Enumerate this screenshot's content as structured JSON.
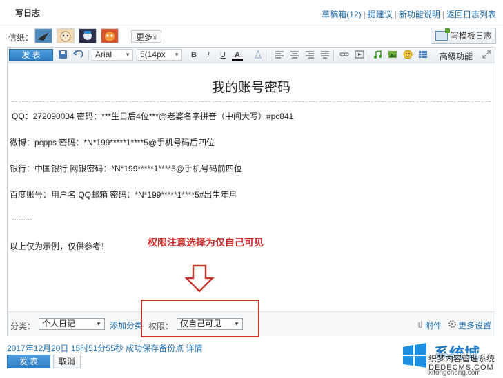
{
  "header": {
    "title": "写日志",
    "links": [
      "草稿箱(12)",
      "提建议",
      "新功能说明",
      "返回日志列表"
    ],
    "separator": "|"
  },
  "papers": {
    "label": "信纸：",
    "more_label": "更多",
    "more_arrow": "¥",
    "template_button": "写模板日志"
  },
  "toolbar": {
    "publish_label": "发 表",
    "font_family": "Arial",
    "font_size": "5(14px",
    "bold": "B",
    "italic": "I",
    "underline": "U",
    "font_color": "A",
    "advanced": "高级功能"
  },
  "document": {
    "title": "我的账号密码",
    "lines": [
      "QQ：272090034 密码：***生日后4位***@老婆名字拼音（中间大写）#pc841",
      "微博：pcpps 密码：*N*199*****1****5@手机号码后四位",
      "银行：中国银行 网银密码：*N*199*****1****5@手机号码前四位",
      "百度账号：用户名 QQ邮箱 密码：*N*199*****1****5#出生年月",
      "………",
      "以上仅为示例，仅供参考！"
    ],
    "annotation": "权限注意选择为仅自己可见"
  },
  "footer": {
    "category_label": "分类：",
    "category_value": "个人日记",
    "add_category": "添加分类",
    "permission_label": "权限：",
    "permission_value": "仅自己可见",
    "attachment": "附件",
    "more_settings": "更多设置"
  },
  "status": {
    "saved_text": "2017年12月20日 15时51分55秒 成功保存备份点",
    "details_link": "详情"
  },
  "actions": {
    "publish": "发 表",
    "cancel": "取消"
  },
  "watermark": {
    "line1": "系统城",
    "line2": "织梦内容管理系统",
    "line3": "DEDECMS.COM",
    "line4": "xitongcheng.com"
  },
  "colors": {
    "link": "#1f6fb2",
    "accent_button": "#2e7fc7",
    "annotation": "#cc2a2a",
    "highlight_box": "#c0392b"
  }
}
